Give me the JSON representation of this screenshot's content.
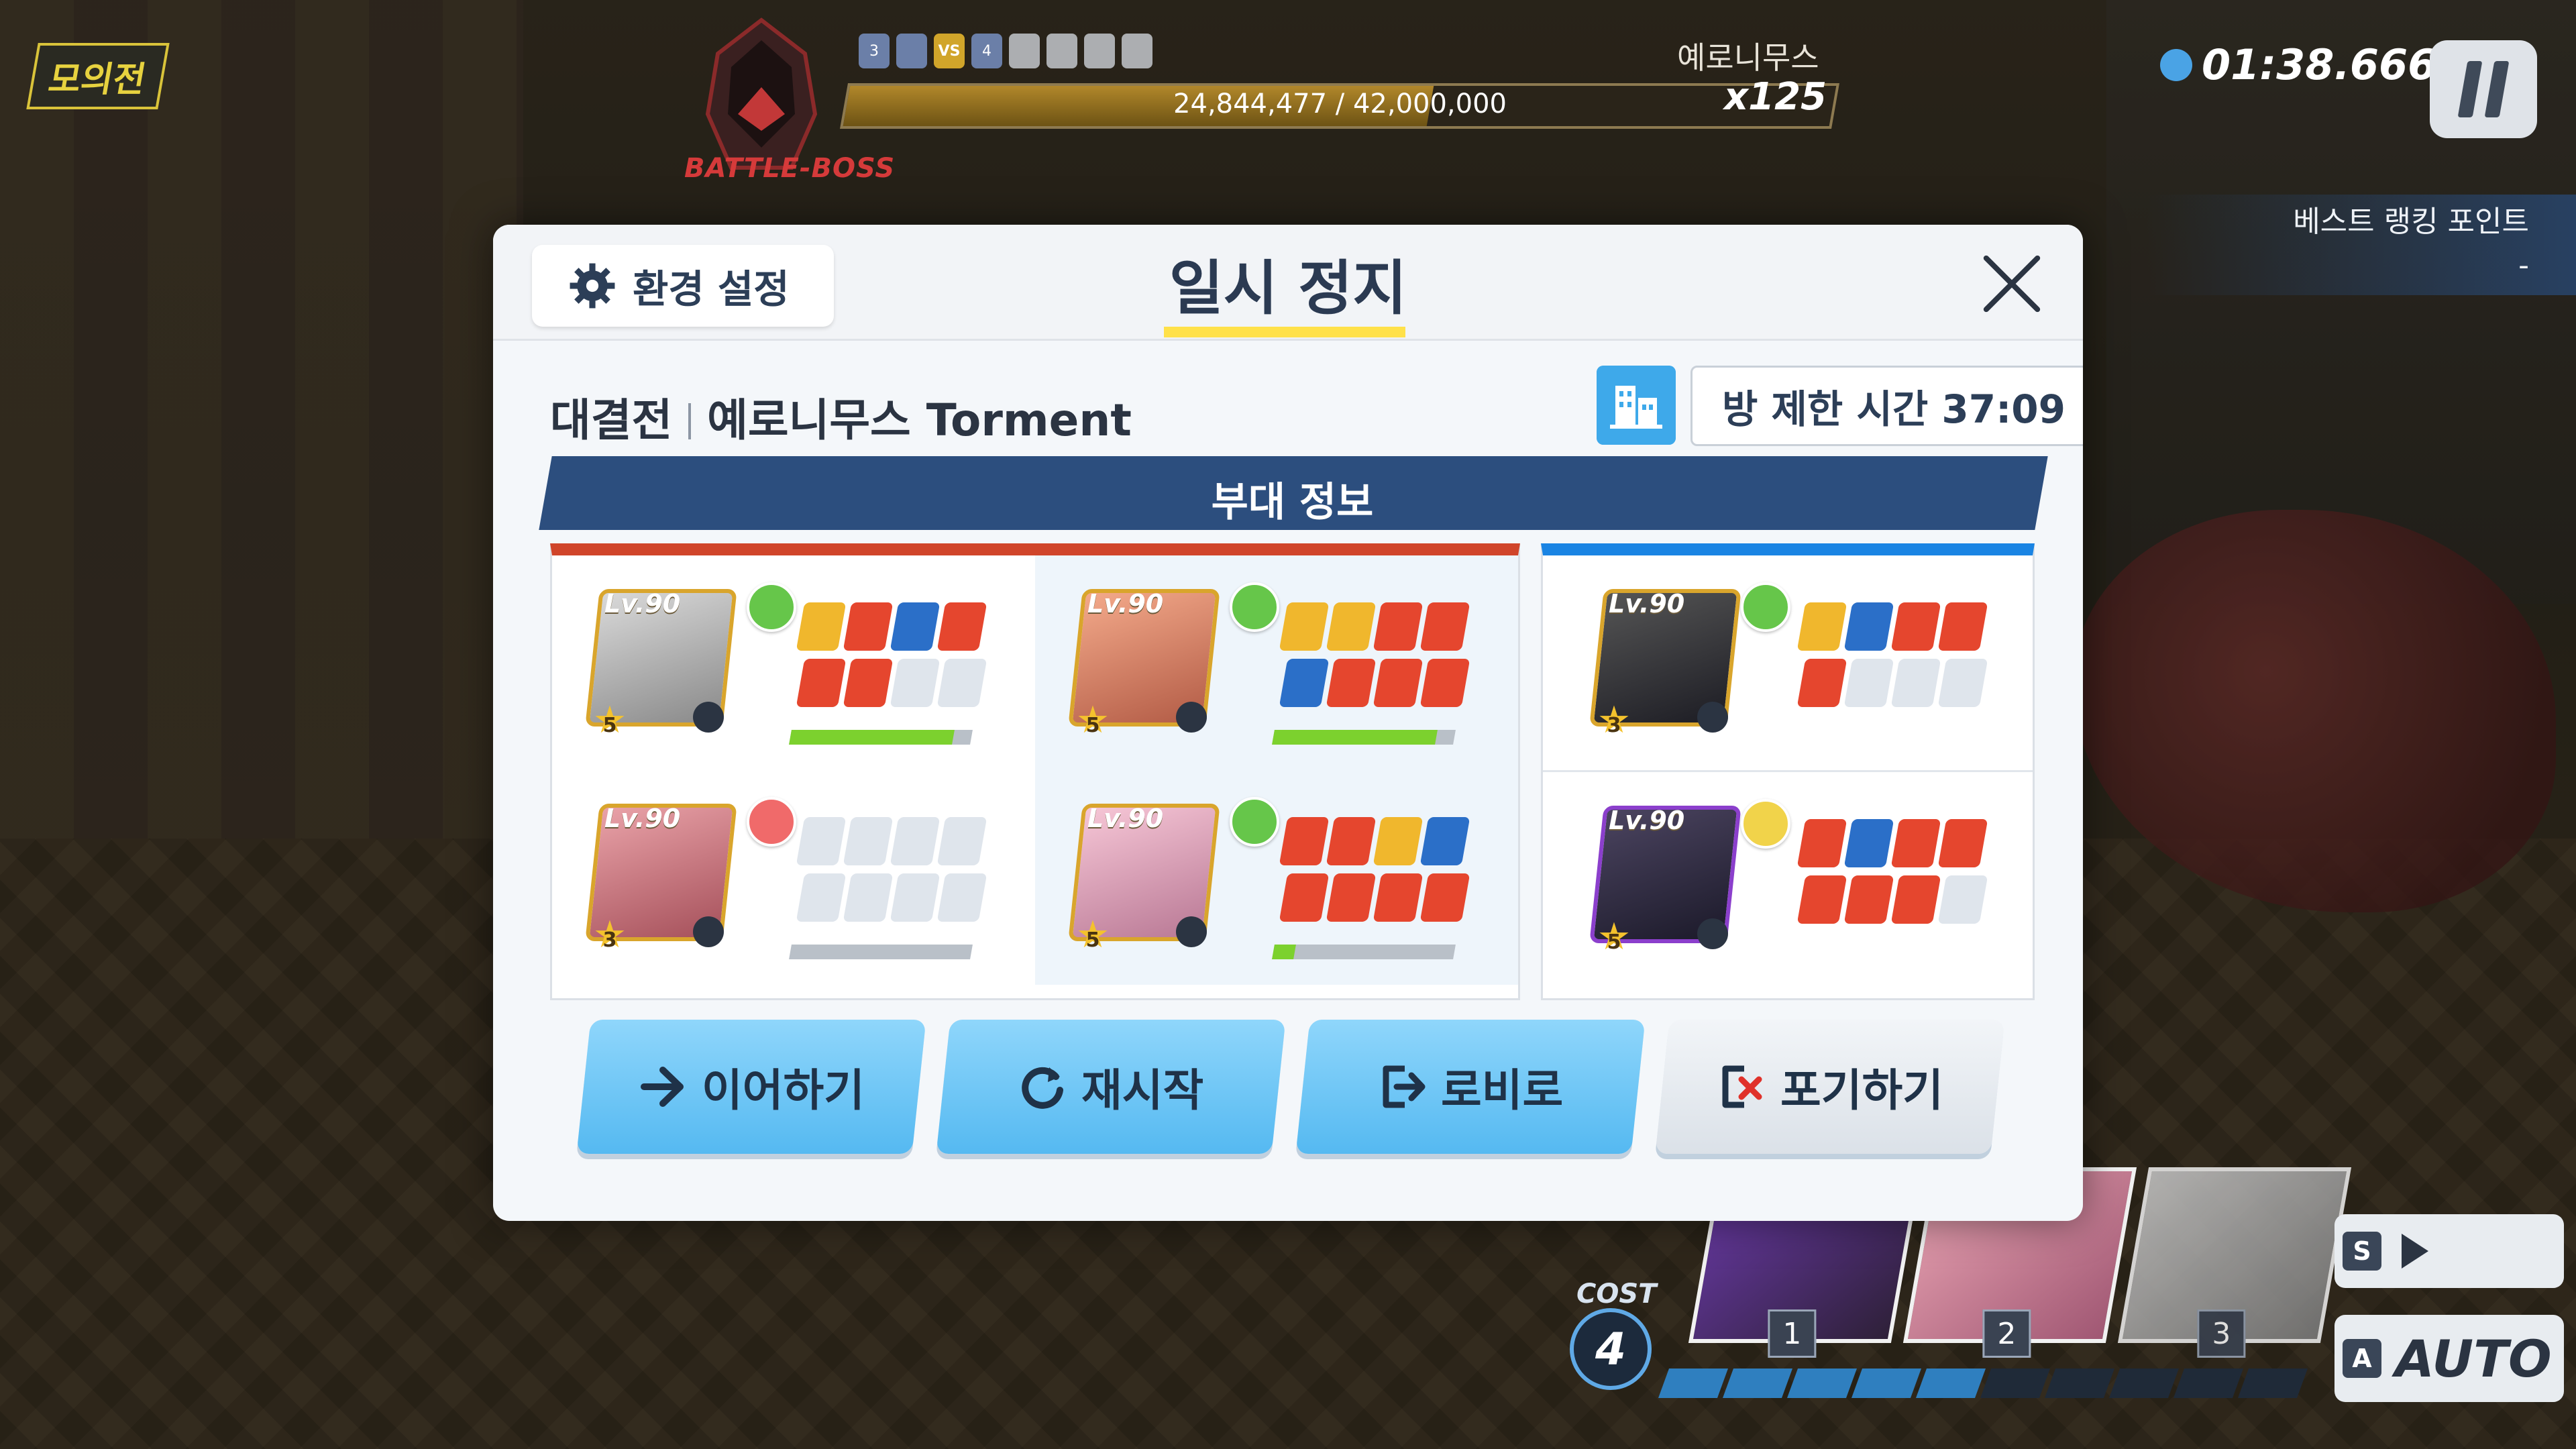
{
  "hud": {
    "mode_tag": "모의전",
    "boss_label": "BATTLE-BOSS",
    "boss_name": "예로니무스",
    "boss_hp_text": "24,844,477 / 42,000,000",
    "boss_hp_fraction": 0.5915,
    "boss_multiplier": "x125",
    "timer": "01:38.666",
    "rank_label": "베스트 랭킹 포인트",
    "rank_value": "-",
    "cost_label": "COST",
    "cost_value": "4",
    "skip_key": "S",
    "auto_key": "A",
    "auto_label": "AUTO",
    "party_slots": [
      "1",
      "2",
      "3"
    ],
    "party_slot3_badge": "3",
    "boss_badges": [
      "3",
      "",
      "VS",
      "4",
      "",
      "",
      "",
      ""
    ]
  },
  "dialog": {
    "settings_label": "환경 설정",
    "title": "일시 정지",
    "battle_type": "대결전",
    "battle_name": "예로니무스 Torment",
    "room_time": "방 제한 시간 37:09",
    "squad_banner": "부대 정보",
    "units_red": [
      {
        "level": "Lv.90",
        "stars": "5",
        "mood": "happy",
        "hp_fraction": 0.9
      },
      {
        "level": "Lv.90",
        "stars": "5",
        "mood": "cool",
        "hp_fraction": 0.9
      },
      {
        "level": "Lv.90",
        "stars": "3",
        "mood": "angry",
        "hp_fraction": 0.0
      },
      {
        "level": "Lv.90",
        "stars": "5",
        "mood": "happy",
        "hp_fraction": 0.12
      }
    ],
    "units_blue": [
      {
        "level": "Lv.90",
        "stars": "3",
        "mood": "happy"
      },
      {
        "level": "Lv.90",
        "stars": "5",
        "mood": "neutral"
      }
    ],
    "buttons": {
      "continue": "이어하기",
      "restart": "재시작",
      "lobby": "로비로",
      "give_up": "포기하기"
    }
  },
  "colors": {
    "accent_blue": "#55b9f1",
    "team_red": "#d0452a",
    "team_blue": "#1a84e3",
    "title_underline": "#ffe14a"
  },
  "icons": [
    "gear-icon",
    "close-icon",
    "building-icon",
    "arrow-right-icon",
    "restart-icon",
    "exit-icon",
    "give-up-icon",
    "pause-icon",
    "clock-icon",
    "play-icon"
  ]
}
